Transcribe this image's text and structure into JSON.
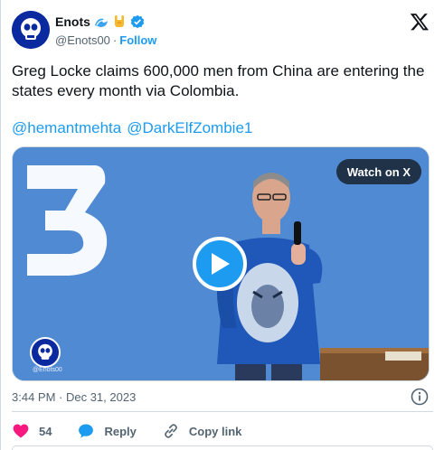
{
  "author": {
    "name": "Enots",
    "handle": "@Enots00",
    "separator": "·",
    "follow_label": "Follow"
  },
  "tweet": {
    "text": "Greg Locke claims 600,000 men from China are entering the states every month via Colombia.",
    "mentions": [
      "@hemantmehta",
      "@DarkElfZombie1"
    ]
  },
  "media": {
    "watch_label": "Watch on X",
    "watermark": "@Enots00"
  },
  "meta": {
    "timestamp": "3:44 PM · Dec 31, 2023"
  },
  "actions": {
    "like_count": "54",
    "reply_label": "Reply",
    "copy_label": "Copy link"
  },
  "colors": {
    "accent": "#1d9bf0",
    "like": "#f91880",
    "text_secondary": "#536471"
  }
}
